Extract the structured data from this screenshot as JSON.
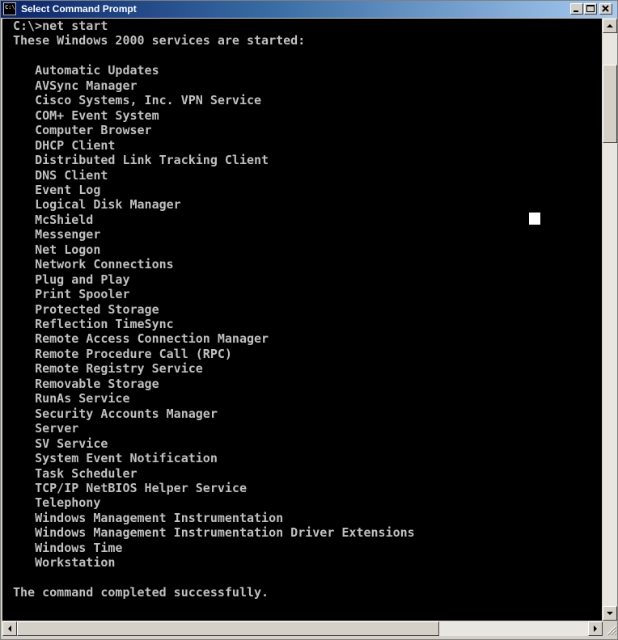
{
  "window": {
    "title": "Select Command Prompt",
    "icon_name": "console-icon",
    "icon_glyph": "C:\\",
    "title_gradient": [
      "#0a246a",
      "#a6caf0"
    ]
  },
  "console": {
    "background": "#000000",
    "text_color": "#c0c0c0",
    "lines": [
      "C:\\>net start",
      "These Windows 2000 services are started:",
      "",
      "   Automatic Updates",
      "   AVSync Manager",
      "   Cisco Systems, Inc. VPN Service",
      "   COM+ Event System",
      "   Computer Browser",
      "   DHCP Client",
      "   Distributed Link Tracking Client",
      "   DNS Client",
      "   Event Log",
      "   Logical Disk Manager",
      "   McShield",
      "   Messenger",
      "   Net Logon",
      "   Network Connections",
      "   Plug and Play",
      "   Print Spooler",
      "   Protected Storage",
      "   Reflection TimeSync",
      "   Remote Access Connection Manager",
      "   Remote Procedure Call (RPC)",
      "   Remote Registry Service",
      "   Removable Storage",
      "   RunAs Service",
      "   Security Accounts Manager",
      "   Server",
      "   SV Service",
      "   System Event Notification",
      "   Task Scheduler",
      "   TCP/IP NetBIOS Helper Service",
      "   Telephony",
      "   Windows Management Instrumentation",
      "   Windows Management Instrumentation Driver Extensions",
      "   Windows Time",
      "   Workstation",
      "",
      "The command completed successfully."
    ]
  },
  "scrollbars": {
    "vertical": {
      "up_icon": "arrow-up-icon",
      "down_icon": "arrow-down-icon"
    },
    "horizontal": {
      "left_icon": "arrow-left-icon",
      "right_icon": "arrow-right-icon"
    }
  }
}
